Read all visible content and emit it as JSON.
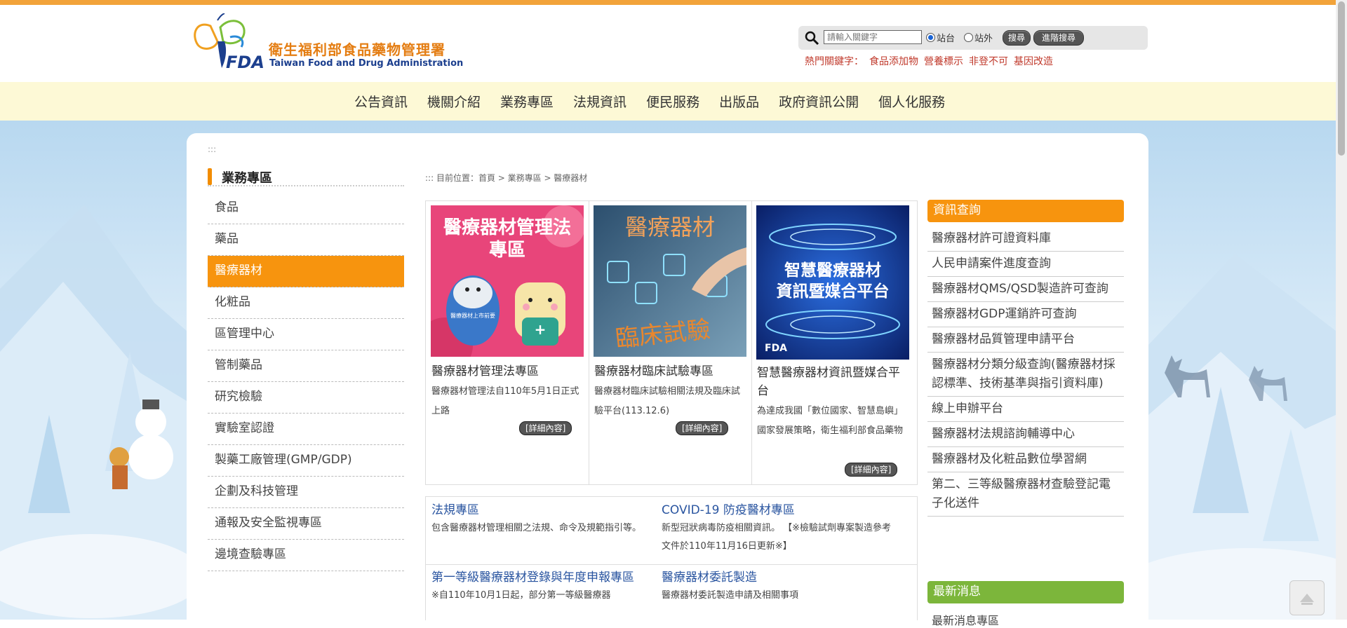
{
  "header": {
    "logo_cn": "衛生福利部食品藥物管理署",
    "logo_en": "Taiwan Food and Drug Administration",
    "logo_fda": "FDA"
  },
  "search": {
    "placeholder": "請輸入關鍵字",
    "radio_site": "站台",
    "radio_outside": "站外",
    "search_button": "搜尋",
    "advanced_button": "進階搜尋",
    "hot_label": "熱門關鍵字：",
    "hot_keywords": [
      "食品添加物",
      "營養標示",
      "非登不可",
      "基因改造"
    ]
  },
  "nav": [
    "公告資訊",
    "機關介紹",
    "業務專區",
    "法規資訊",
    "便民服務",
    "出版品",
    "政府資訊公開",
    "個人化服務"
  ],
  "sidebar": {
    "dots": ":::",
    "title": "業務專區",
    "items": [
      "食品",
      "藥品",
      "醫療器材",
      "化粧品",
      "區管理中心",
      "管制藥品",
      "研究檢驗",
      "實驗室認證",
      "製藥工廠管理(GMP/GDP)",
      "企劃及科技管理",
      "通報及安全監視專區",
      "邊境查驗專區"
    ],
    "active_index": 2
  },
  "breadcrumb": "::: 目前位置：首頁 > 業務專區 > 醫療器材",
  "cards": [
    {
      "image_text": "醫療器材管理法專區",
      "image_caption": "醫療器材上市前要",
      "title": "醫療器材管理法專區",
      "desc": "醫療器材管理法自110年5月1日正式上路",
      "more": "[詳細內容]"
    },
    {
      "image_text_top": "醫療器材",
      "image_text_bottom": "臨床試驗",
      "title": "醫療器材臨床試驗專區",
      "desc": "醫療器材臨床試驗相關法規及臨床試驗平台(113.12.6)",
      "more": "[詳細內容]"
    },
    {
      "image_text_1": "智慧醫療器材",
      "image_text_2": "資訊暨媒合平台",
      "title": "智慧醫療器材資訊暨媒合平台",
      "desc": "為達成我國「數位國家、智慧島嶼」國家發展策略，衛生福利部食品藥物",
      "more": "[詳細內容]"
    }
  ],
  "links": [
    {
      "title": "法規專區",
      "desc": "包含醫療器材管理相關之法規、命令及規範指引等。"
    },
    {
      "title": "COVID-19 防疫醫材專區",
      "desc": "新型冠狀病毒防疫相關資訊。 【※檢驗試劑專案製造參考文件於110年11月16日更新※】"
    },
    {
      "title": "第一等級醫療器材登錄與年度申報專區",
      "desc": "※自110年10月1日起，部分第一等級醫療器"
    },
    {
      "title": "醫療器材委託製造",
      "desc": "醫療器材委託製造申請及相關事項"
    }
  ],
  "right": {
    "query_title": "資訊查詢",
    "items": [
      "醫療器材許可證資料庫",
      "人民申請案件進度查詢",
      "醫療器材QMS/QSD製造許可查詢",
      "醫療器材GDP運銷許可查詢",
      "醫療器材品質管理申請平台",
      "醫療器材分類分級查詢(醫療器材採認標準、技術基準與指引資料庫)",
      "線上申辦平台",
      "醫療器材法規諮詢輔導中心",
      "醫療器材及化粧品數位學習網",
      "第二、三等級醫療器材查驗登記電子化送件"
    ],
    "news_title": "最新消息",
    "news_first": "最新消息專區"
  },
  "colors": {
    "accent": "#f7940e",
    "nav_bg": "#fdf9d6",
    "news": "#7cb63b",
    "link": "#2a55a0"
  }
}
